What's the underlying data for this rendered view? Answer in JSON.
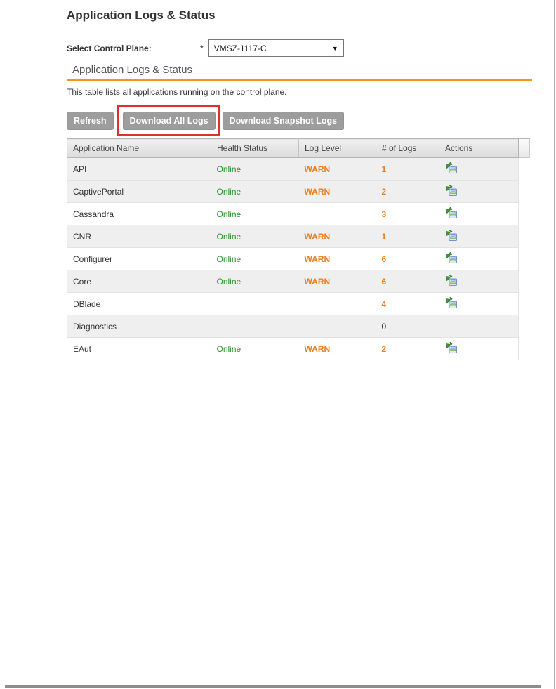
{
  "page": {
    "title": "Application Logs & Status"
  },
  "control_plane": {
    "label": "Select Control Plane:",
    "required_marker": "*",
    "selected_value": "VMSZ-1117-C",
    "caret_icon": "chevron-down-icon"
  },
  "section": {
    "title": "Application Logs & Status",
    "description": "This table lists all applications running on the control plane.",
    "accent_color": "#F7941E"
  },
  "toolbar": {
    "refresh_label": "Refresh",
    "download_all_label": "Download All Logs",
    "download_snapshot_label": "Download Snapshot Logs",
    "annotation_color": "#DF3030"
  },
  "table": {
    "columns": [
      "Application Name",
      "Health Status",
      "Log Level",
      "# of Logs",
      "Actions"
    ],
    "action_icon": "download-log-icon",
    "rows": [
      {
        "name": "API",
        "health": "Online",
        "log_level": "WARN",
        "logs": "1",
        "has_action": true
      },
      {
        "name": "CaptivePortal",
        "health": "Online",
        "log_level": "WARN",
        "logs": "2",
        "has_action": true
      },
      {
        "name": "Cassandra",
        "health": "Online",
        "log_level": "",
        "logs": "3",
        "has_action": true
      },
      {
        "name": "CNR",
        "health": "Online",
        "log_level": "WARN",
        "logs": "1",
        "has_action": true
      },
      {
        "name": "Configurer",
        "health": "Online",
        "log_level": "WARN",
        "logs": "6",
        "has_action": true
      },
      {
        "name": "Core",
        "health": "Online",
        "log_level": "WARN",
        "logs": "6",
        "has_action": true
      },
      {
        "name": "DBlade",
        "health": "",
        "log_level": "",
        "logs": "4",
        "has_action": true
      },
      {
        "name": "Diagnostics",
        "health": "",
        "log_level": "",
        "logs": "0",
        "has_action": false
      },
      {
        "name": "EAut",
        "health": "Online",
        "log_level": "WARN",
        "logs": "2",
        "has_action": true
      }
    ]
  },
  "colors": {
    "online_green": "#2E9333",
    "warn_orange": "#EF7D1A",
    "count_orange": "#EF7D1A",
    "zero_count_gray": "#333333"
  }
}
